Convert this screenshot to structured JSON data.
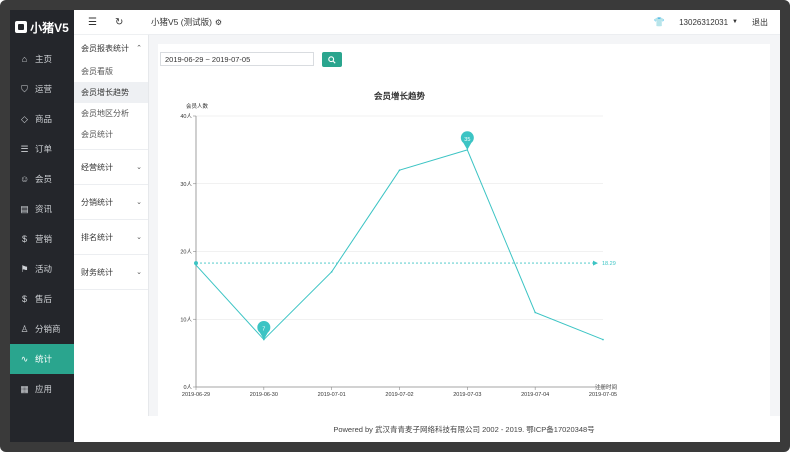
{
  "brand": {
    "name": "小猪V5"
  },
  "sidebar": {
    "items": [
      {
        "icon": "home-icon",
        "glyph": "⌂",
        "label": "主页"
      },
      {
        "icon": "shield-icon",
        "glyph": "⛉",
        "label": "运营"
      },
      {
        "icon": "tag-icon",
        "glyph": "◇",
        "label": "商品"
      },
      {
        "icon": "list-icon",
        "glyph": "☰",
        "label": "订单"
      },
      {
        "icon": "user-icon",
        "glyph": "☺",
        "label": "会员"
      },
      {
        "icon": "document-icon",
        "glyph": "▤",
        "label": "资讯"
      },
      {
        "icon": "coin-icon",
        "glyph": "$",
        "label": "营销"
      },
      {
        "icon": "flag-icon",
        "glyph": "⚑",
        "label": "活动"
      },
      {
        "icon": "coin-icon",
        "glyph": "$",
        "label": "售后"
      },
      {
        "icon": "person-icon",
        "glyph": "♙",
        "label": "分销商"
      },
      {
        "icon": "pulse-icon",
        "glyph": "∿",
        "label": "统计"
      },
      {
        "icon": "grid-icon",
        "glyph": "▦",
        "label": "应用"
      }
    ],
    "active_index": 10
  },
  "subnav": {
    "groups": [
      {
        "label": "会员报表统计",
        "expanded": true,
        "items": [
          "会员看版",
          "会员增长趋势",
          "会员地区分析",
          "会员统计"
        ]
      },
      {
        "label": "经营统计",
        "expanded": false,
        "items": []
      },
      {
        "label": "分销统计",
        "expanded": false,
        "items": []
      },
      {
        "label": "排名统计",
        "expanded": false,
        "items": []
      },
      {
        "label": "财务统计",
        "expanded": false,
        "items": []
      }
    ],
    "selected_item": "会员增长趋势"
  },
  "header": {
    "title": "小猪V5 (测试版)",
    "account": "13026312031",
    "logout": "退出"
  },
  "filter": {
    "date_range": "2019-06-29 ~ 2019-07-05"
  },
  "footer": {
    "text": "Powered by 武汉青青麦子网络科技有限公司 2002 - 2019. 鄂ICP备17020348号"
  },
  "chart_data": {
    "type": "line",
    "title": "会员增长趋势",
    "ylabel": "会员人数",
    "xlabel": "注册时间",
    "x": [
      "2019-06-29",
      "2019-06-30",
      "2019-07-01",
      "2019-07-02",
      "2019-07-03",
      "2019-07-04",
      "2019-07-05"
    ],
    "values": [
      18,
      7,
      17,
      32,
      35,
      11,
      7
    ],
    "ylim": [
      0,
      40
    ],
    "yticks": [
      "0人",
      "10人",
      "20人",
      "30人",
      "40人"
    ],
    "average": 18.29,
    "average_label": "18.29",
    "max_label": "35",
    "min_label": "7",
    "color": "#3cc4c4",
    "grid": true
  }
}
